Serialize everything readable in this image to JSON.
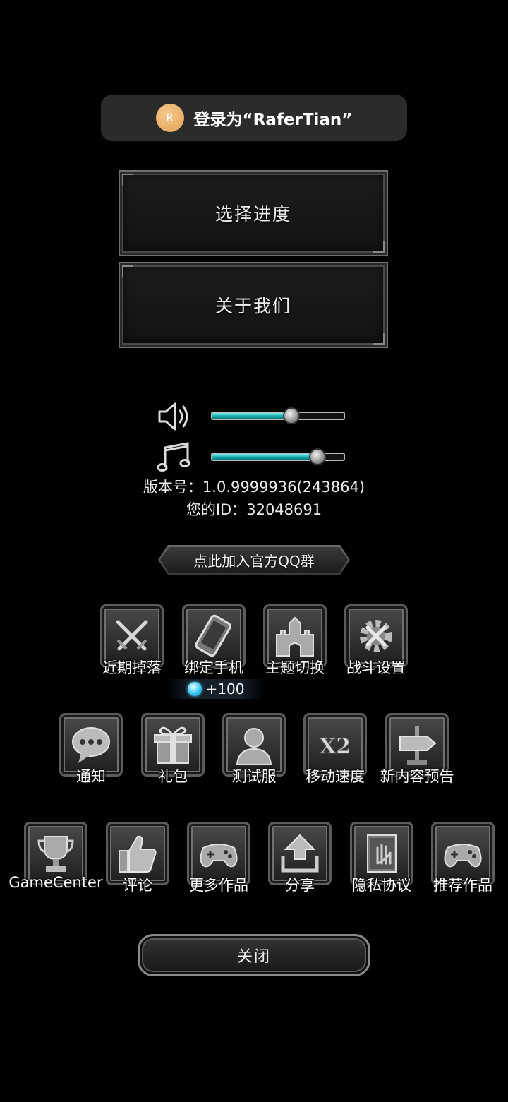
{
  "login": {
    "avatar_letter": "R",
    "text": "登录为“RaferTian”"
  },
  "menu": {
    "select_progress": "选择进度",
    "about_us": "关于我们"
  },
  "audio": {
    "sound_level": 0.6,
    "music_level": 0.8
  },
  "info": {
    "version": "版本号：1.0.9999936(243864)",
    "user_id": "您的ID：32048691"
  },
  "qq_group": "点此加入官方QQ群",
  "row1": [
    {
      "label": "近期掉落",
      "icon": "crossed-swords-icon"
    },
    {
      "label": "绑定手机",
      "icon": "phone-icon"
    },
    {
      "label": "主题切换",
      "icon": "castle-icon"
    },
    {
      "label": "战斗设置",
      "icon": "gear-tools-icon"
    }
  ],
  "reward": "+100",
  "row2": [
    {
      "label": "通知",
      "icon": "speech-bubble-icon"
    },
    {
      "label": "礼包",
      "icon": "gift-icon"
    },
    {
      "label": "测试服",
      "icon": "person-icon"
    },
    {
      "label": "移动速度",
      "icon": "x2-icon",
      "icon_text": "X2"
    },
    {
      "label": "新内容预告",
      "icon": "signpost-icon"
    }
  ],
  "row3": [
    {
      "label": "GameCenter",
      "icon": "trophy-icon"
    },
    {
      "label": "评论",
      "icon": "thumbs-up-icon"
    },
    {
      "label": "更多作品",
      "icon": "gamepad-icon"
    },
    {
      "label": "分享",
      "icon": "share-icon"
    },
    {
      "label": "隐私协议",
      "icon": "book-hand-icon"
    },
    {
      "label": "推荐作品",
      "icon": "gamepad-icon"
    }
  ],
  "close_label": "关闭"
}
